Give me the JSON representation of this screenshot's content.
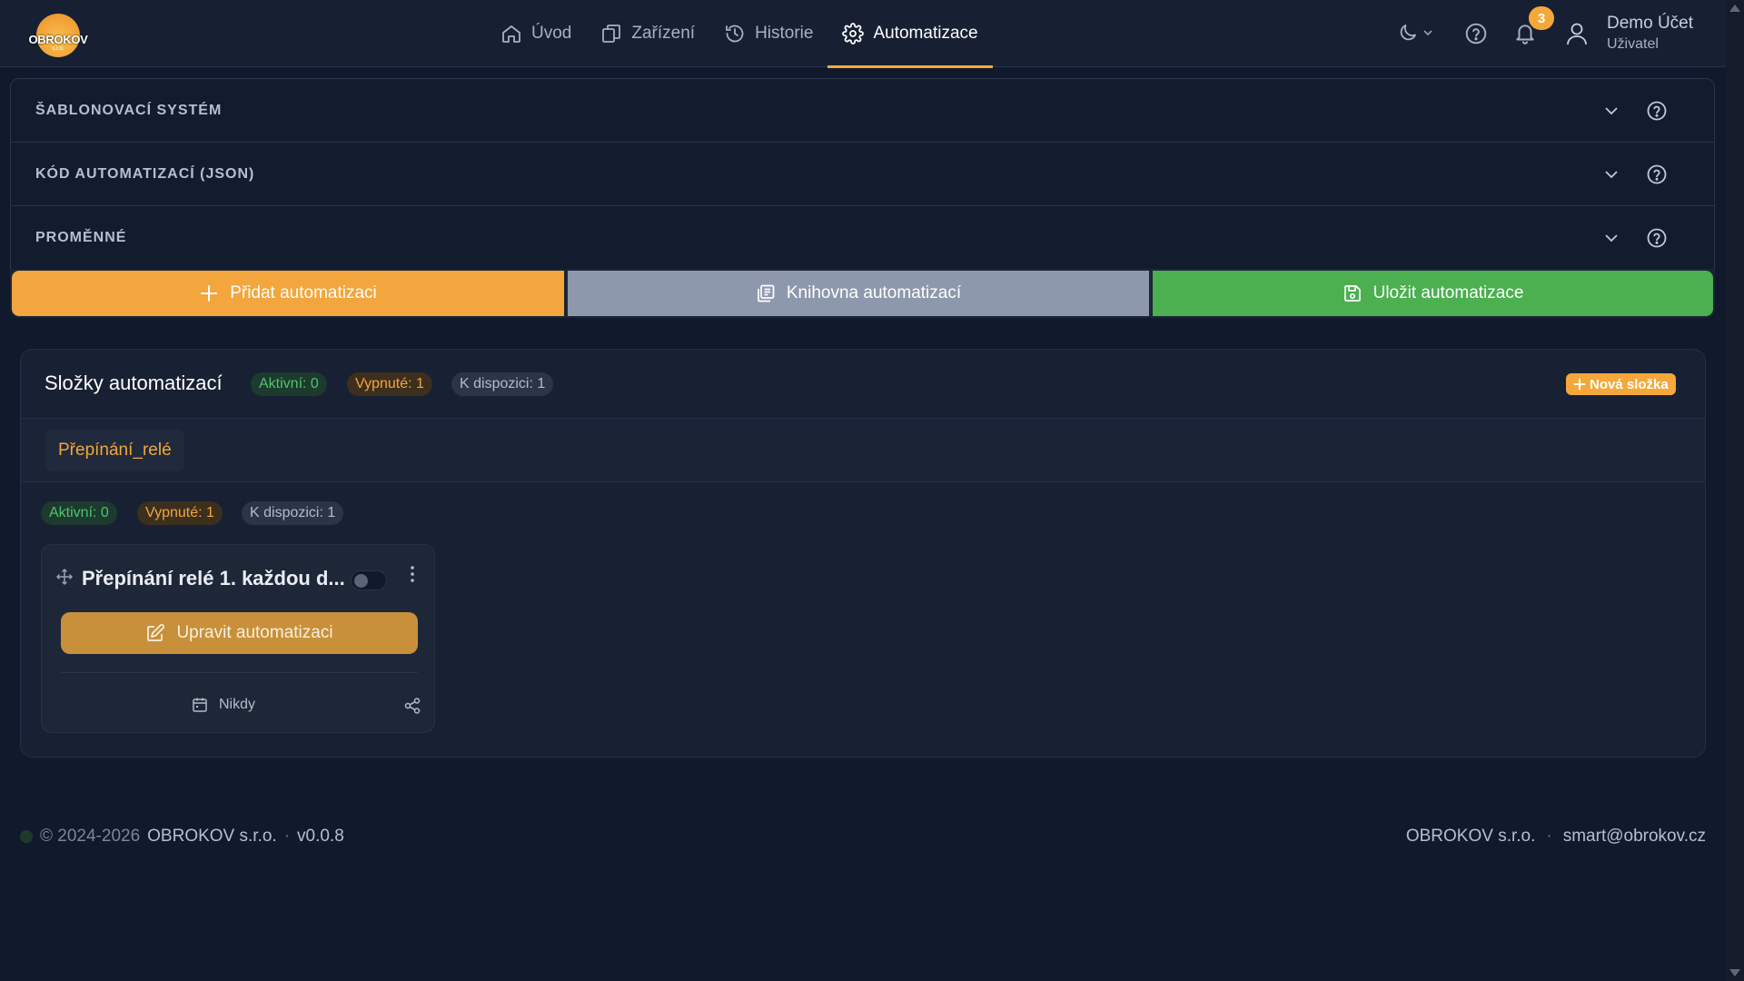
{
  "brand": {
    "name": "OBROKOV",
    "suffix": "s.r.o."
  },
  "nav": {
    "items": [
      {
        "label": "Úvod",
        "icon": "home-icon"
      },
      {
        "label": "Zařízení",
        "icon": "devices-icon"
      },
      {
        "label": "Historie",
        "icon": "history-icon"
      },
      {
        "label": "Automatizace",
        "icon": "gear-icon",
        "active": true
      }
    ]
  },
  "header": {
    "notifications_count": "3",
    "user_name": "Demo Účet",
    "user_role": "Uživatel"
  },
  "accordion": {
    "sections": [
      {
        "title": "ŠABLONOVACÍ SYSTÉM"
      },
      {
        "title": "KÓD AUTOMATIZACÍ (JSON)"
      },
      {
        "title": "PROMĚNNÉ"
      }
    ]
  },
  "actions": {
    "add": "Přidat automatizaci",
    "library": "Knihovna automatizací",
    "save": "Uložit automatizace"
  },
  "folders": {
    "title": "Složky automatizací",
    "active": "Aktivní: 0",
    "disabled": "Vypnuté: 1",
    "available": "K dispozici: 1",
    "new_folder": "Nová složka",
    "tabs": [
      "Přepínání_relé"
    ]
  },
  "folder_content": {
    "active": "Aktivní: 0",
    "disabled": "Vypnuté: 1",
    "available": "K dispozici: 1"
  },
  "card": {
    "title": "Přepínání relé 1. každou d...",
    "enabled": false,
    "edit_label": "Upravit automatizaci",
    "schedule": "Nikdy"
  },
  "footer": {
    "copyright": "© 2024-2026",
    "company": "OBROKOV s.r.o.",
    "separator": "·",
    "version": "v0.0.8",
    "right_company": "OBROKOV s.r.o.",
    "email": "smart@obrokov.cz"
  },
  "colors": {
    "background": "#111a2c",
    "accent_orange": "#f3a63d",
    "library_gray": "#8e98ac",
    "save_green": "#4caf50",
    "edit_gold": "#c8903a"
  }
}
